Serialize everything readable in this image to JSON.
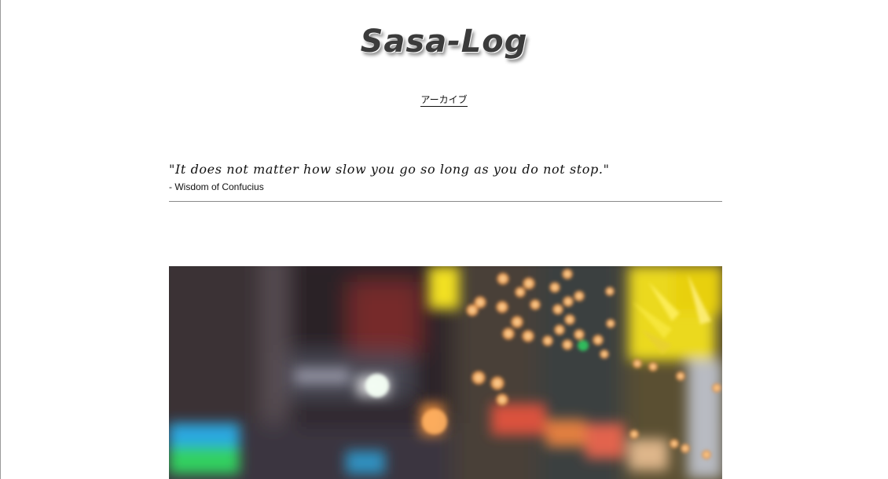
{
  "site": {
    "title": "Sasa-Log"
  },
  "nav": {
    "items": [
      {
        "label": "アーカイブ"
      }
    ]
  },
  "quote": {
    "text": "\"It does not matter how slow you go so long as you do not stop.\"",
    "author": "- Wisdom of Confucius"
  },
  "hero": {
    "icon": "blurred-city-lights-photo",
    "colors": {
      "bokeh_orange": "#f0b060",
      "neon_yellow": "#f2e020",
      "neon_green": "#30d060",
      "neon_blue": "#2aa8e0"
    }
  }
}
